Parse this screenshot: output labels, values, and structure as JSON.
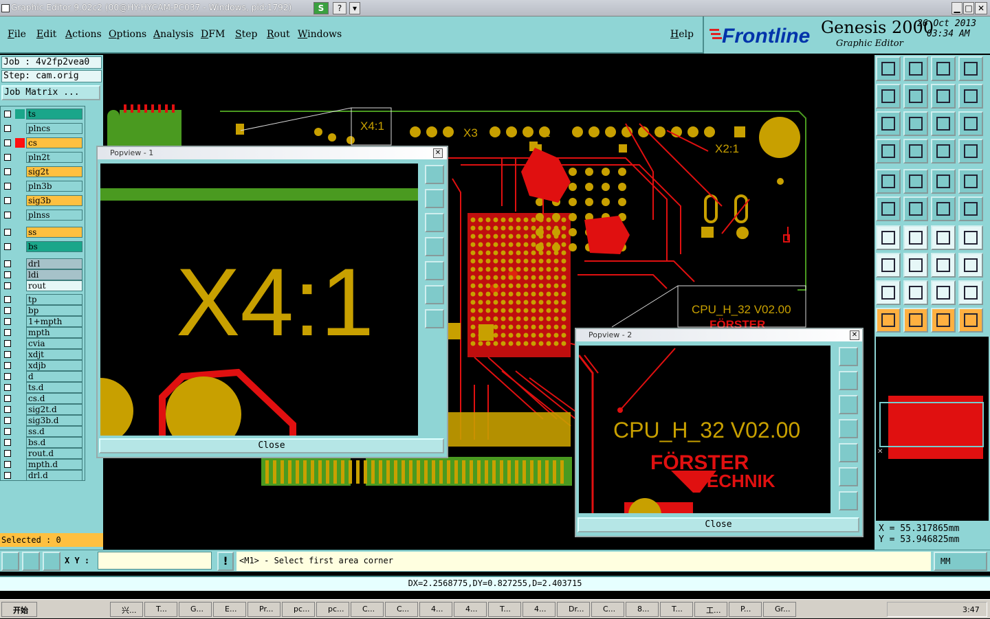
{
  "window": {
    "title": "Graphic Editor 9.02c2 (00@HY-HYCAM-PC037 - Windows, pid:1792)",
    "controls": [
      "?",
      "▾"
    ]
  },
  "menu": [
    "File",
    "Edit",
    "Actions",
    "Options",
    "Analysis",
    "DFM",
    "Step",
    "Rout",
    "Windows"
  ],
  "help_label": "Help",
  "brand": {
    "logo": "Frontline",
    "product": "Genesis 2000",
    "subtitle": "Graphic Editor",
    "date": "26 Oct 2013",
    "time": "03:34 AM"
  },
  "job": {
    "job": "Job : 4v2fp2vea0",
    "step": "Step: cam.orig",
    "matrix_button": "Job Matrix ..."
  },
  "layers": [
    {
      "name": "ts",
      "bg": "#1aa68a",
      "sw": "#1aa68a"
    },
    {
      "name": "plncs",
      "bg": "#8fd5d5",
      "sw": ""
    },
    {
      "name": "cs",
      "bg": "#ffc040",
      "sw": "#ff1010"
    },
    {
      "name": "pln2t",
      "bg": "#8fd5d5",
      "sw": ""
    },
    {
      "name": "sig2t",
      "bg": "#ffc040",
      "sw": ""
    },
    {
      "name": "pln3b",
      "bg": "#8fd5d5",
      "sw": ""
    },
    {
      "name": "sig3b",
      "bg": "#ffc040",
      "sw": ""
    },
    {
      "name": "plnss",
      "bg": "#8fd5d5",
      "sw": ""
    },
    {
      "name": "ss",
      "bg": "#ffc040",
      "sw": ""
    },
    {
      "name": "bs",
      "bg": "#1aa68a",
      "sw": ""
    },
    {
      "name": "drl",
      "bg": "#a6c2c9",
      "sw": ""
    },
    {
      "name": "ldi",
      "bg": "#a6c2c9",
      "sw": ""
    },
    {
      "name": "rout",
      "bg": "#e6f7f7",
      "sw": ""
    },
    {
      "name": "tp",
      "bg": "#8fd5d5",
      "sw": ""
    },
    {
      "name": "bp",
      "bg": "#8fd5d5",
      "sw": ""
    },
    {
      "name": "1+mpth",
      "bg": "#8fd5d5",
      "sw": ""
    },
    {
      "name": "mpth",
      "bg": "#8fd5d5",
      "sw": ""
    },
    {
      "name": "cvia",
      "bg": "#8fd5d5",
      "sw": ""
    },
    {
      "name": "xdjt",
      "bg": "#8fd5d5",
      "sw": ""
    },
    {
      "name": "xdjb",
      "bg": "#8fd5d5",
      "sw": ""
    },
    {
      "name": "d",
      "bg": "#8fd5d5",
      "sw": ""
    },
    {
      "name": "ts.d",
      "bg": "#8fd5d5",
      "sw": ""
    },
    {
      "name": "cs.d",
      "bg": "#8fd5d5",
      "sw": ""
    },
    {
      "name": "sig2t.d",
      "bg": "#8fd5d5",
      "sw": ""
    },
    {
      "name": "sig3b.d",
      "bg": "#8fd5d5",
      "sw": ""
    },
    {
      "name": "ss.d",
      "bg": "#8fd5d5",
      "sw": ""
    },
    {
      "name": "bs.d",
      "bg": "#8fd5d5",
      "sw": ""
    },
    {
      "name": "rout.d",
      "bg": "#8fd5d5",
      "sw": ""
    },
    {
      "name": "mpth.d",
      "bg": "#8fd5d5",
      "sw": ""
    },
    {
      "name": "drl.d",
      "bg": "#8fd5d5",
      "sw": ""
    }
  ],
  "selected": "Selected : 0",
  "board_labels": {
    "x4": "X4:1",
    "x3": "X3",
    "one": "1",
    "x2": "X2:1",
    "cpu": "CPU_H_32 V02.00",
    "forster": "FÖRSTER",
    "technik": "TECHNIK"
  },
  "popview1": {
    "title": "Popview - 1",
    "label": "X4:1",
    "close": "Close"
  },
  "popview2": {
    "title": "Popview - 2",
    "label": "CPU_H_32 V02.00",
    "logo1": "FÖRSTER",
    "logo2": "TECHNIK",
    "close": "Close"
  },
  "coords": {
    "x": "X  =  55.317865mm",
    "y": "Y  =  53.946825mm"
  },
  "command": {
    "xy_label": "X Y :",
    "input_value": "",
    "prompt": "<M1> - Select first area corner",
    "units": "MM"
  },
  "status": "DX=2.2568775,DY=0.827255,D=2.403715",
  "taskbar": {
    "start": "开始",
    "items": [
      "兴...",
      "T...",
      "G...",
      "E...",
      "Pr...",
      "pc...",
      "pc...",
      "C...",
      "C...",
      "4...",
      "4...",
      "T...",
      "4...",
      "Dr...",
      "C...",
      "8...",
      "T...",
      "工...",
      "P...",
      "Gr..."
    ],
    "clock": "3:47"
  },
  "colors": {
    "teal": "#8fd5d5",
    "copper": "#c8a000",
    "trace": "#e01010",
    "mask": "#4a9a20"
  }
}
